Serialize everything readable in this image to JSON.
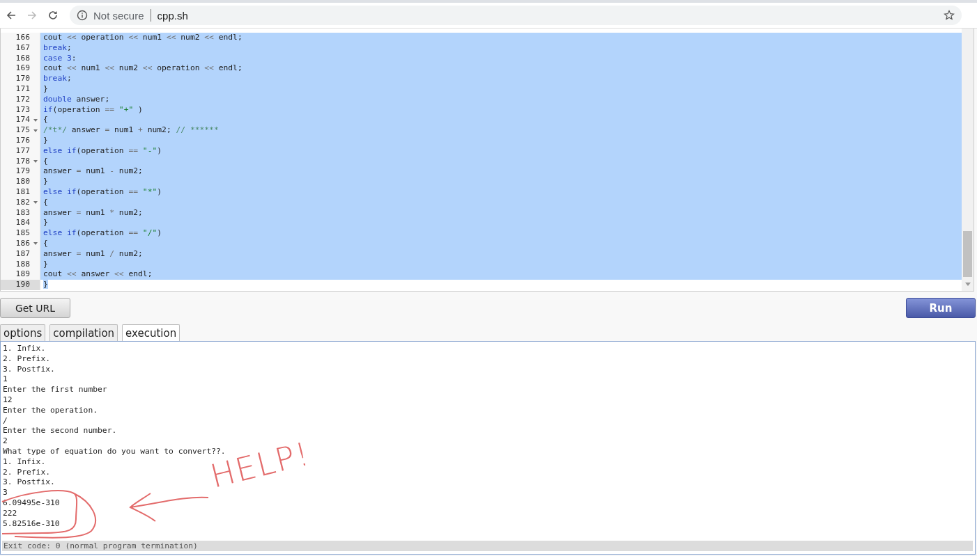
{
  "browser": {
    "security": "Not secure",
    "url": "cpp.sh",
    "back_disabled": false,
    "forward_disabled": true
  },
  "editor": {
    "lines": [
      {
        "n": "166",
        "fold": false,
        "selected": true,
        "cursor": false,
        "tokens": [
          {
            "kind": "plain",
            "text": "cout "
          },
          {
            "kind": "operator",
            "text": "<<"
          },
          {
            "kind": "plain",
            "text": " operation "
          },
          {
            "kind": "operator",
            "text": "<<"
          },
          {
            "kind": "plain",
            "text": " num1 "
          },
          {
            "kind": "operator",
            "text": "<<"
          },
          {
            "kind": "plain",
            "text": " num2 "
          },
          {
            "kind": "operator",
            "text": "<<"
          },
          {
            "kind": "plain",
            "text": " endl;"
          }
        ]
      },
      {
        "n": "167",
        "fold": false,
        "selected": true,
        "cursor": false,
        "tokens": [
          {
            "kind": "keyword",
            "text": "break"
          },
          {
            "kind": "plain",
            "text": ";"
          }
        ]
      },
      {
        "n": "168",
        "fold": false,
        "selected": true,
        "cursor": false,
        "tokens": [
          {
            "kind": "keyword",
            "text": "case 3"
          },
          {
            "kind": "plain",
            "text": ":"
          }
        ]
      },
      {
        "n": "169",
        "fold": false,
        "selected": true,
        "cursor": false,
        "tokens": [
          {
            "kind": "plain",
            "text": "cout "
          },
          {
            "kind": "operator",
            "text": "<<"
          },
          {
            "kind": "plain",
            "text": " num1 "
          },
          {
            "kind": "operator",
            "text": "<<"
          },
          {
            "kind": "plain",
            "text": " num2 "
          },
          {
            "kind": "operator",
            "text": "<<"
          },
          {
            "kind": "plain",
            "text": " operation "
          },
          {
            "kind": "operator",
            "text": "<<"
          },
          {
            "kind": "plain",
            "text": " endl;"
          }
        ]
      },
      {
        "n": "170",
        "fold": false,
        "selected": true,
        "cursor": false,
        "tokens": [
          {
            "kind": "keyword",
            "text": "break"
          },
          {
            "kind": "plain",
            "text": ";"
          }
        ]
      },
      {
        "n": "171",
        "fold": false,
        "selected": true,
        "cursor": false,
        "tokens": [
          {
            "kind": "plain",
            "text": "}"
          }
        ]
      },
      {
        "n": "172",
        "fold": false,
        "selected": true,
        "cursor": false,
        "tokens": [
          {
            "kind": "keyword",
            "text": "double"
          },
          {
            "kind": "plain",
            "text": " answer;"
          }
        ]
      },
      {
        "n": "173",
        "fold": false,
        "selected": true,
        "cursor": false,
        "tokens": [
          {
            "kind": "keyword",
            "text": "if"
          },
          {
            "kind": "plain",
            "text": "(operation "
          },
          {
            "kind": "operator",
            "text": "=="
          },
          {
            "kind": "string",
            "text": " \"+\""
          },
          {
            "kind": "plain",
            "text": " )"
          }
        ]
      },
      {
        "n": "174",
        "fold": true,
        "selected": true,
        "cursor": false,
        "tokens": [
          {
            "kind": "plain",
            "text": "{"
          }
        ]
      },
      {
        "n": "175",
        "fold": true,
        "selected": true,
        "cursor": false,
        "tokens": [
          {
            "kind": "comment",
            "text": "/*t*/"
          },
          {
            "kind": "plain",
            "text": " answer "
          },
          {
            "kind": "operator",
            "text": "="
          },
          {
            "kind": "plain",
            "text": " num1 "
          },
          {
            "kind": "operator",
            "text": "+"
          },
          {
            "kind": "plain",
            "text": " num2; "
          },
          {
            "kind": "comment",
            "text": "// ******"
          }
        ]
      },
      {
        "n": "176",
        "fold": false,
        "selected": true,
        "cursor": false,
        "tokens": [
          {
            "kind": "plain",
            "text": "}"
          }
        ]
      },
      {
        "n": "177",
        "fold": false,
        "selected": true,
        "cursor": false,
        "tokens": [
          {
            "kind": "keyword",
            "text": "else if"
          },
          {
            "kind": "plain",
            "text": "(operation "
          },
          {
            "kind": "operator",
            "text": "=="
          },
          {
            "kind": "string",
            "text": " \"-\""
          },
          {
            "kind": "plain",
            "text": ")"
          }
        ]
      },
      {
        "n": "178",
        "fold": true,
        "selected": true,
        "cursor": false,
        "tokens": [
          {
            "kind": "plain",
            "text": "{"
          }
        ]
      },
      {
        "n": "179",
        "fold": false,
        "selected": true,
        "cursor": false,
        "tokens": [
          {
            "kind": "plain",
            "text": "answer "
          },
          {
            "kind": "operator",
            "text": "="
          },
          {
            "kind": "plain",
            "text": " num1 "
          },
          {
            "kind": "operator",
            "text": "-"
          },
          {
            "kind": "plain",
            "text": " num2;"
          }
        ]
      },
      {
        "n": "180",
        "fold": false,
        "selected": true,
        "cursor": false,
        "tokens": [
          {
            "kind": "plain",
            "text": "}"
          }
        ]
      },
      {
        "n": "181",
        "fold": false,
        "selected": true,
        "cursor": false,
        "tokens": [
          {
            "kind": "keyword",
            "text": "else if"
          },
          {
            "kind": "plain",
            "text": "(operation "
          },
          {
            "kind": "operator",
            "text": "=="
          },
          {
            "kind": "string",
            "text": " \"*\""
          },
          {
            "kind": "plain",
            "text": ")"
          }
        ]
      },
      {
        "n": "182",
        "fold": true,
        "selected": true,
        "cursor": false,
        "tokens": [
          {
            "kind": "plain",
            "text": "{"
          }
        ]
      },
      {
        "n": "183",
        "fold": false,
        "selected": true,
        "cursor": false,
        "tokens": [
          {
            "kind": "plain",
            "text": "answer "
          },
          {
            "kind": "operator",
            "text": "="
          },
          {
            "kind": "plain",
            "text": " num1 "
          },
          {
            "kind": "operator",
            "text": "*"
          },
          {
            "kind": "plain",
            "text": " num2;"
          }
        ]
      },
      {
        "n": "184",
        "fold": false,
        "selected": true,
        "cursor": false,
        "tokens": [
          {
            "kind": "plain",
            "text": "}"
          }
        ]
      },
      {
        "n": "185",
        "fold": false,
        "selected": true,
        "cursor": false,
        "tokens": [
          {
            "kind": "keyword",
            "text": "else if"
          },
          {
            "kind": "plain",
            "text": "(operation "
          },
          {
            "kind": "operator",
            "text": "=="
          },
          {
            "kind": "string",
            "text": " \"/\""
          },
          {
            "kind": "plain",
            "text": ")"
          }
        ]
      },
      {
        "n": "186",
        "fold": true,
        "selected": true,
        "cursor": false,
        "tokens": [
          {
            "kind": "plain",
            "text": "{"
          }
        ]
      },
      {
        "n": "187",
        "fold": false,
        "selected": true,
        "cursor": false,
        "tokens": [
          {
            "kind": "plain",
            "text": "answer "
          },
          {
            "kind": "operator",
            "text": "="
          },
          {
            "kind": "plain",
            "text": " num1 "
          },
          {
            "kind": "operator",
            "text": "/"
          },
          {
            "kind": "plain",
            "text": " num2;"
          }
        ]
      },
      {
        "n": "188",
        "fold": false,
        "selected": true,
        "cursor": false,
        "tokens": [
          {
            "kind": "plain",
            "text": "}"
          }
        ]
      },
      {
        "n": "189",
        "fold": false,
        "selected": true,
        "cursor": false,
        "tokens": [
          {
            "kind": "plain",
            "text": "cout "
          },
          {
            "kind": "operator",
            "text": "<<"
          },
          {
            "kind": "plain",
            "text": " answer "
          },
          {
            "kind": "operator",
            "text": "<<"
          },
          {
            "kind": "plain",
            "text": " endl;"
          }
        ]
      },
      {
        "n": "190",
        "fold": false,
        "selected": false,
        "cursor": true,
        "tokens": [
          {
            "kind": "plain",
            "text": "}"
          }
        ]
      }
    ]
  },
  "buttons": {
    "get_url": "Get URL",
    "run": "Run"
  },
  "tabs": [
    {
      "label": "options",
      "selected": false
    },
    {
      "label": "compilation",
      "selected": false
    },
    {
      "label": "execution",
      "selected": true
    }
  ],
  "output": {
    "lines": [
      "1. Infix.",
      "2. Prefix.",
      "3. Postfix.",
      "1",
      "Enter the first number",
      "12",
      "Enter the operation.",
      "/",
      "Enter the second number.",
      "2",
      "What type of equation do you want to convert??.",
      "1. Infix.",
      "2. Prefix.",
      "3. Postfix.",
      "3",
      "6.09495e-310",
      "222",
      "5.82516e-310"
    ],
    "exit_status": "Exit code: 0 (normal program termination)"
  },
  "annotation": {
    "text": "HELP!"
  }
}
